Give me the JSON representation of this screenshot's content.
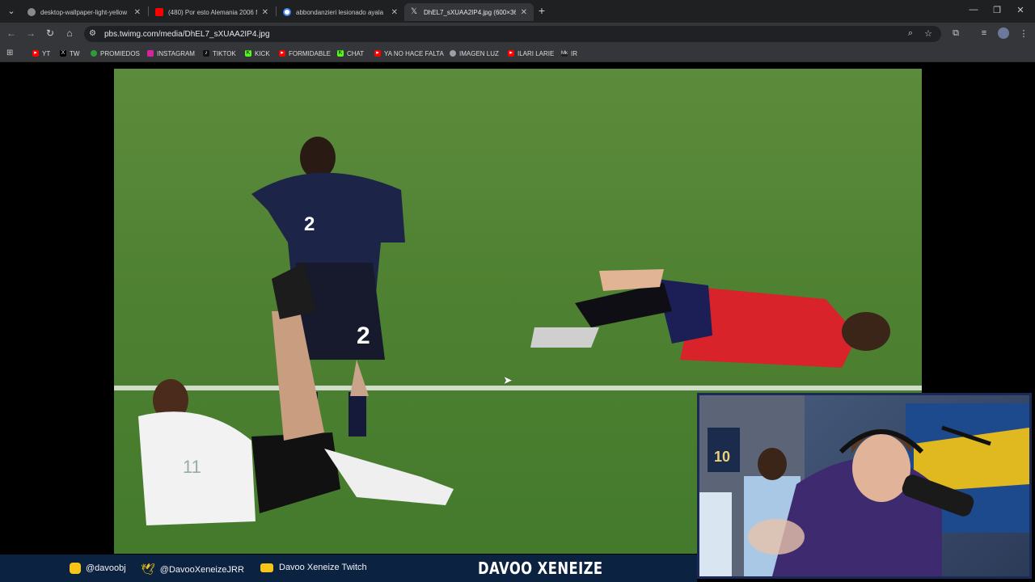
{
  "tabs": [
    {
      "title": "desktop-wallpaper-light-yellow",
      "favicon_color": "#8a8a8a",
      "active": false
    },
    {
      "title": "(480) Por esto Alemania 2006 fu",
      "favicon_color": "#ff0000",
      "active": false
    },
    {
      "title": "abbondanzieri lesionado ayala",
      "favicon_color": "#4285f4",
      "active": false
    },
    {
      "title": "DhEL7_sXUAA2IP4.jpg (600×36",
      "favicon_color": "#000000",
      "active": true
    }
  ],
  "address": {
    "url": "pbs.twimg.com/media/DhEL7_sXUAA2IP4.jpg"
  },
  "bookmarks": [
    {
      "label": "YT",
      "icon": "youtube-icon",
      "color": "#ff0000"
    },
    {
      "label": "TW",
      "icon": "x-icon",
      "color": "#000000"
    },
    {
      "label": "PROMIEDOS",
      "icon": "ball-icon",
      "color": "#2e9b3a"
    },
    {
      "label": "INSTAGRAM",
      "icon": "instagram-icon",
      "color": "#d6249f"
    },
    {
      "label": "TIKTOK",
      "icon": "tiktok-icon",
      "color": "#111111"
    },
    {
      "label": "KICK",
      "icon": "kick-icon",
      "color": "#53fc18"
    },
    {
      "label": "FORMIDABLE",
      "icon": "youtube-icon",
      "color": "#ff0000"
    },
    {
      "label": "CHAT",
      "icon": "kick-icon",
      "color": "#53fc18"
    },
    {
      "label": "YA NO HACE FALTA",
      "icon": "youtube-icon",
      "color": "#ff0000"
    },
    {
      "label": "IMAGEN LUZ",
      "icon": "globe-icon",
      "color": "#9aa0a6"
    },
    {
      "label": "ILARI LARIE",
      "icon": "youtube-icon",
      "color": "#ff0000"
    },
    {
      "label": "IR",
      "icon": "mk-icon",
      "color": "#222222"
    }
  ],
  "photo": {
    "player_top_number": "2",
    "player_bottom_number": "11"
  },
  "overlay": {
    "instagram": "@davoobj",
    "twitter": "@DavooXeneizeJRR",
    "twitch": "Davoo Xeneize Twitch",
    "brand": "DAVOO XENEIZE"
  },
  "webcam": {
    "poster_number": "10"
  }
}
